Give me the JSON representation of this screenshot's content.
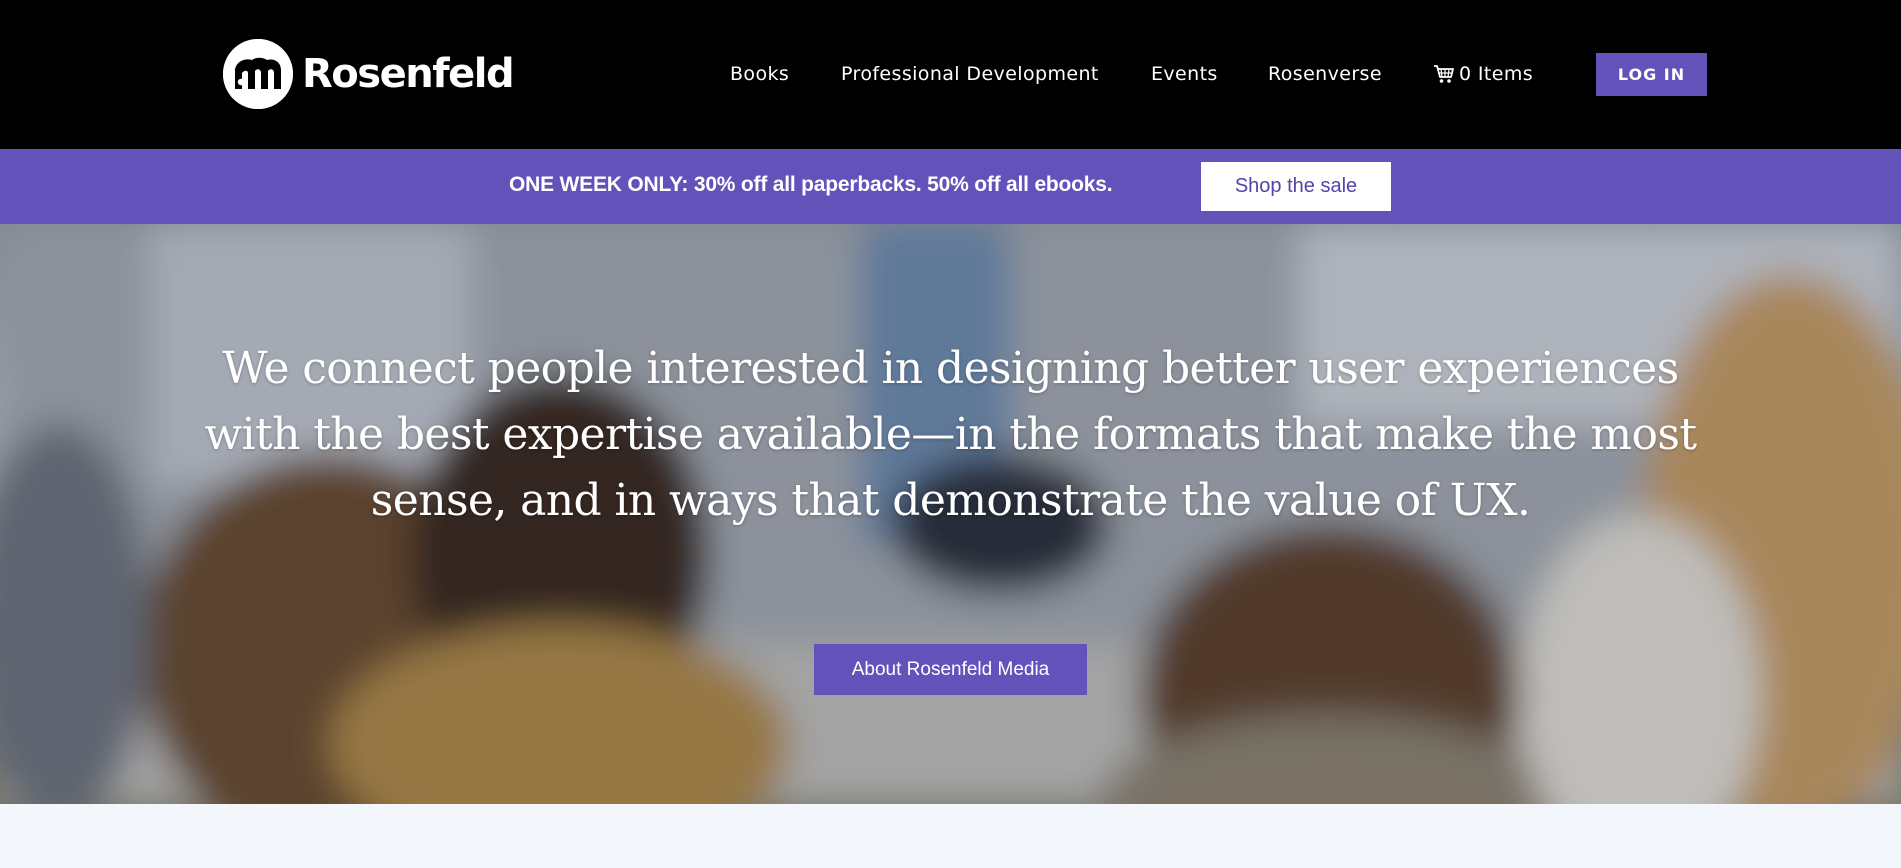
{
  "header": {
    "logo_text": "Rosenfeld",
    "nav": {
      "books": "Books",
      "professional_development": "Professional Development",
      "events": "Events",
      "rosenverse": "Rosenverse",
      "cart": "0 Items"
    },
    "cart_icon": "shopping-cart-icon",
    "login_label": "LOG IN"
  },
  "promo": {
    "text": "ONE WEEK ONLY: 30% off all paperbacks. 50% off all ebooks.",
    "button_label": "Shop the sale"
  },
  "hero": {
    "headline": "We connect people interested in designing better user experiences with the best expertise available—in the formats that make the most sense, and in ways that demonstrate the value of UX.",
    "button_label": "About Rosenfeld Media",
    "background": "blurred classroom photo"
  },
  "colors": {
    "header_bg": "#000000",
    "accent": "#6352b9",
    "promo_button_text": "#5244a8",
    "page_bg": "#f3f7fb"
  }
}
